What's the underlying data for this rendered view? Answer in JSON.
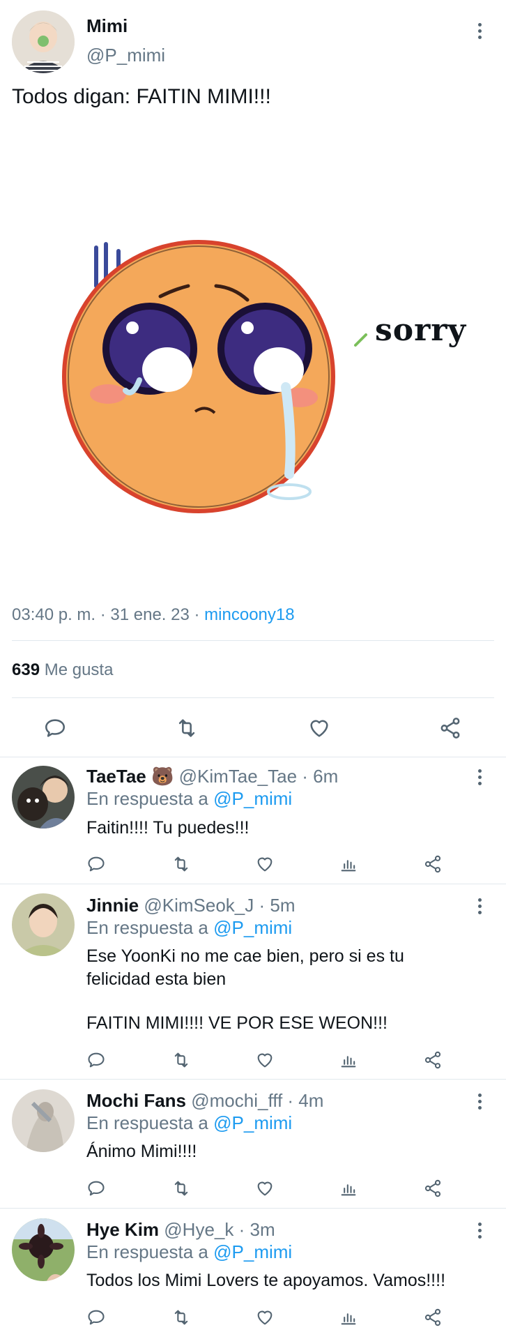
{
  "tweet": {
    "display_name": "Mimi",
    "handle": "@P_mimi",
    "text": "Todos digan: FAITIN MIMI!!!",
    "image_caption": "sorry",
    "time": "03:40 p. m. · 31 ene. 23 · ",
    "source": "mincoony18",
    "likes_count": "639",
    "likes_label": " Me gusta"
  },
  "actions": {
    "reply": "reply-icon",
    "retweet": "retweet-icon",
    "like": "heart-icon",
    "share": "share-icon"
  },
  "replies": [
    {
      "name": "TaeTae 🐻",
      "handle": "@KimTae_Tae",
      "time": " · 6m",
      "reply_prefix": "En respuesta a ",
      "reply_to": "@P_mimi",
      "text": "Faitin!!!! Tu puedes!!!"
    },
    {
      "name": "Jinnie",
      "handle": "@KimSeok_J",
      "time": " · 5m",
      "reply_prefix": "En respuesta a ",
      "reply_to": "@P_mimi",
      "text_line1": "Ese YoonKi no me cae bien, pero si es tu",
      "text_line2": "felicidad esta bien",
      "text_line3": "FAITIN MIMI!!!! VE POR ESE WEON!!!"
    },
    {
      "name": "Mochi Fans",
      "handle": "@mochi_fff",
      "time": " · 4m",
      "reply_prefix": "En respuesta a ",
      "reply_to": "@P_mimi",
      "text": "Ánimo Mimi!!!!"
    },
    {
      "name": "Hye Kim",
      "handle": "@Hye_k",
      "time": " · 3m",
      "reply_prefix": "En respuesta a ",
      "reply_to": "@P_mimi",
      "text": "Todos los Mimi Lovers te apoyamos. Vamos!!!!"
    }
  ],
  "colors": {
    "accent": "#1d9bf0",
    "muted": "#657786",
    "divider": "#e1e8ed"
  }
}
